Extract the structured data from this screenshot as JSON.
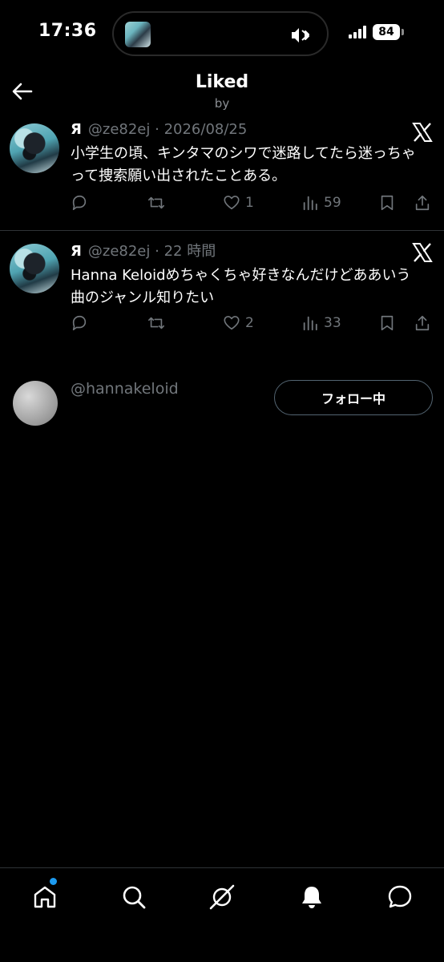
{
  "status_bar": {
    "time": "17:36",
    "battery": "84"
  },
  "header": {
    "title": "Liked",
    "subtitle": "by"
  },
  "tweets": [
    {
      "name": "Я",
      "handle": "@ze82ej",
      "date": "· 2026/08/25",
      "text": "小学生の頃、キンタマのシワで迷路してたら迷っちゃって捜索願い出されたことある。",
      "likes": "1",
      "views": "59"
    },
    {
      "name": "Я",
      "handle": "@ze82ej",
      "date": "· 22 時間",
      "text": "Hanna Keloidめちゃくちゃ好きなんだけどああいう曲のジャンル知りたい",
      "likes": "2",
      "views": "33"
    }
  ],
  "user": {
    "handle": "@hannakeloid",
    "follow_label": "フォロー中"
  },
  "colors": {
    "accent": "#1d9bf0",
    "muted": "#71767b",
    "background": "#000000"
  },
  "icons": {
    "nav": [
      "home-icon",
      "search-icon",
      "grok-icon",
      "notifications-bell-icon",
      "messages-icon"
    ],
    "tweet_actions": [
      "reply-icon",
      "retweet-icon",
      "like-heart-icon",
      "views-icon",
      "bookmark-icon",
      "share-icon"
    ]
  }
}
